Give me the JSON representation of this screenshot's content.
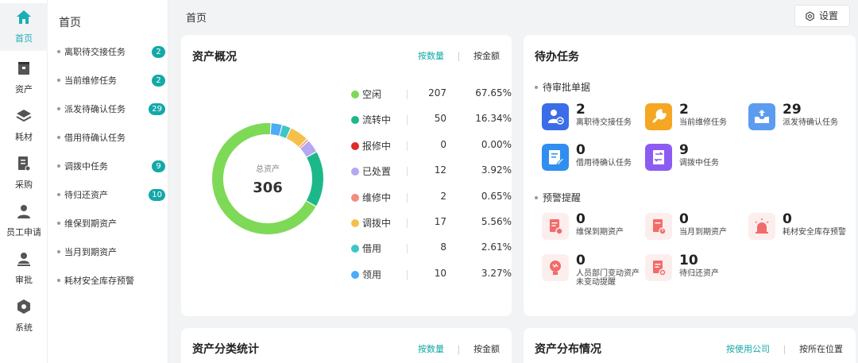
{
  "rail": [
    {
      "label": "首页",
      "icon": "home-icon",
      "active": true
    },
    {
      "label": "资产",
      "icon": "asset-icon"
    },
    {
      "label": "耗材",
      "icon": "layers-icon"
    },
    {
      "label": "采购",
      "icon": "purchase-icon"
    },
    {
      "label": "员工申请",
      "icon": "user-icon"
    },
    {
      "label": "审批",
      "icon": "approve-icon"
    },
    {
      "label": "系统",
      "icon": "system-icon"
    }
  ],
  "menu": {
    "title": "首页",
    "items": [
      {
        "label": "离职待交接任务",
        "badge": "2"
      },
      {
        "label": "当前维修任务",
        "badge": "2"
      },
      {
        "label": "派发待确认任务",
        "badge": "29"
      },
      {
        "label": "借用待确认任务",
        "badge": ""
      },
      {
        "label": "调拨中任务",
        "badge": "9"
      },
      {
        "label": "待归还资产",
        "badge": "10"
      },
      {
        "label": "维保到期资产",
        "badge": ""
      },
      {
        "label": "当月到期资产",
        "badge": ""
      },
      {
        "label": "耗材安全库存预警",
        "badge": ""
      }
    ]
  },
  "header": {
    "breadcrumb": "首页",
    "settings_label": "设置"
  },
  "overview": {
    "title": "资产概况",
    "toggle_on": "按数量",
    "toggle_off": "按金额",
    "center_label": "总资产",
    "center_value": "306"
  },
  "chart_data": {
    "type": "pie",
    "donut": true,
    "total": 306,
    "categories": [
      "空闲",
      "流转中",
      "报修中",
      "已处置",
      "维修中",
      "调拨中",
      "借用",
      "领用"
    ],
    "values": [
      207,
      50,
      0,
      12,
      2,
      17,
      8,
      10
    ],
    "percent_labels": [
      "67.65%",
      "16.34%",
      "0.00%",
      "3.92%",
      "0.65%",
      "5.56%",
      "2.61%",
      "3.27%"
    ],
    "colors": [
      "#7ed957",
      "#1db88a",
      "#e02b2b",
      "#b4a8f0",
      "#f28b82",
      "#f5c04a",
      "#3cc6c6",
      "#4dabf7"
    ]
  },
  "todo": {
    "title": "待办任务",
    "pending_title": "待审批单据",
    "pending": [
      {
        "num": "2",
        "label": "离职待交接任务",
        "icon": "handover-icon",
        "color": "#3b6de8"
      },
      {
        "num": "2",
        "label": "当前维修任务",
        "icon": "wrench-icon",
        "color": "#f5a623"
      },
      {
        "num": "29",
        "label": "派发待确认任务",
        "icon": "inbox-upload-icon",
        "color": "#5b9cf0"
      },
      {
        "num": "0",
        "label": "借用待确认任务",
        "icon": "edit-doc-icon",
        "color": "#2f8ef0"
      },
      {
        "num": "9",
        "label": "调拨中任务",
        "icon": "transfer-doc-icon",
        "color": "#8c5cf2"
      }
    ],
    "warn_title": "预警提醒",
    "warnings": [
      {
        "num": "0",
        "label": "维保到期资产",
        "icon": "maintenance-alert-icon"
      },
      {
        "num": "0",
        "label": "当月到期资产",
        "icon": "expire-alert-icon"
      },
      {
        "num": "0",
        "label": "耗材安全库存预警",
        "icon": "siren-icon"
      },
      {
        "num": "0",
        "label": "人员部门变动资产未变动提醒",
        "icon": "bulb-alert-icon"
      },
      {
        "num": "10",
        "label": "待归还资产",
        "icon": "return-alert-icon"
      }
    ],
    "warn_color": "#f26b6b",
    "warn_bg": "#fdeeee"
  },
  "category_stats": {
    "title": "资产分类统计",
    "toggle_on": "按数量",
    "toggle_off": "按金额"
  },
  "distribution": {
    "title": "资产分布情况",
    "toggle_on": "按使用公司",
    "toggle_off": "按所在位置"
  }
}
